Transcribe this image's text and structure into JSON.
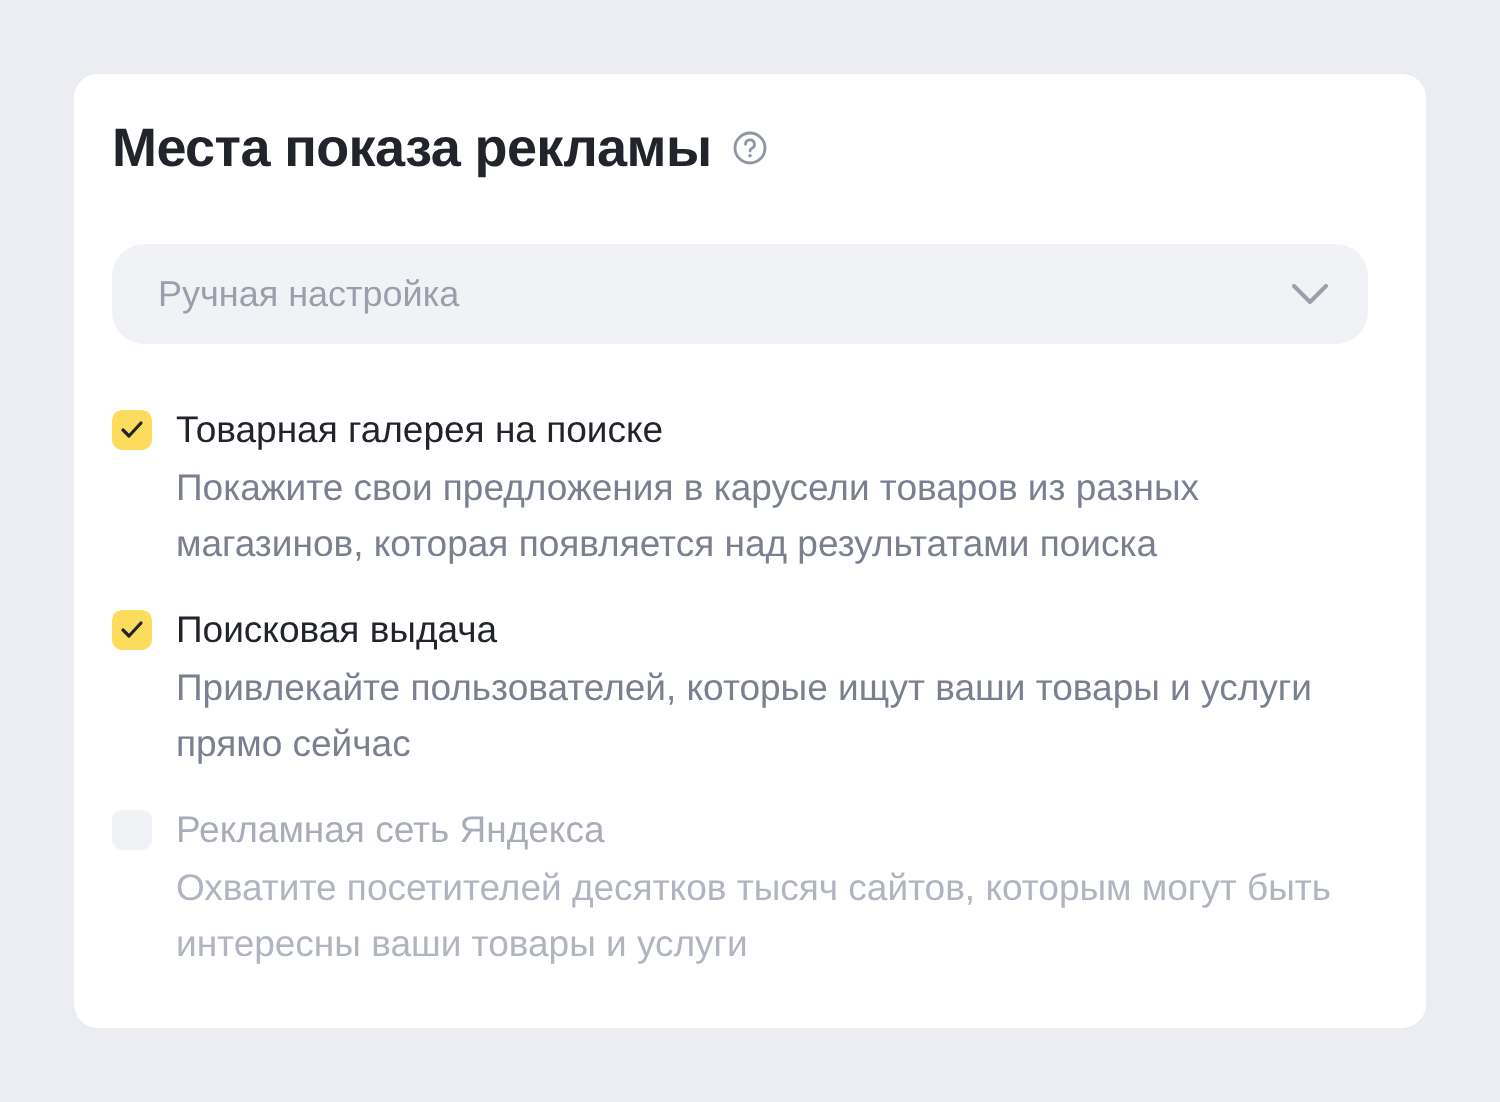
{
  "title": "Места показа рекламы",
  "dropdown": {
    "value": "Ручная настройка",
    "expanded": false
  },
  "options": [
    {
      "label": "Товарная галерея на поиске",
      "description": "Покажите свои предложения в карусели товаров из разных магазинов, которая появляется над результатами поиска",
      "checked": true,
      "disabled": false
    },
    {
      "label": "Поисковая выдача",
      "description": "Привлекайте пользователей, которые ищут ваши товары и услуги прямо сейчас",
      "checked": true,
      "disabled": false
    },
    {
      "label": "Рекламная сеть Яндекса",
      "description": "Охватите посетителей десятков тысяч сайтов, которым могут быть интересны ваши товары и услуги",
      "checked": false,
      "disabled": true
    }
  ]
}
